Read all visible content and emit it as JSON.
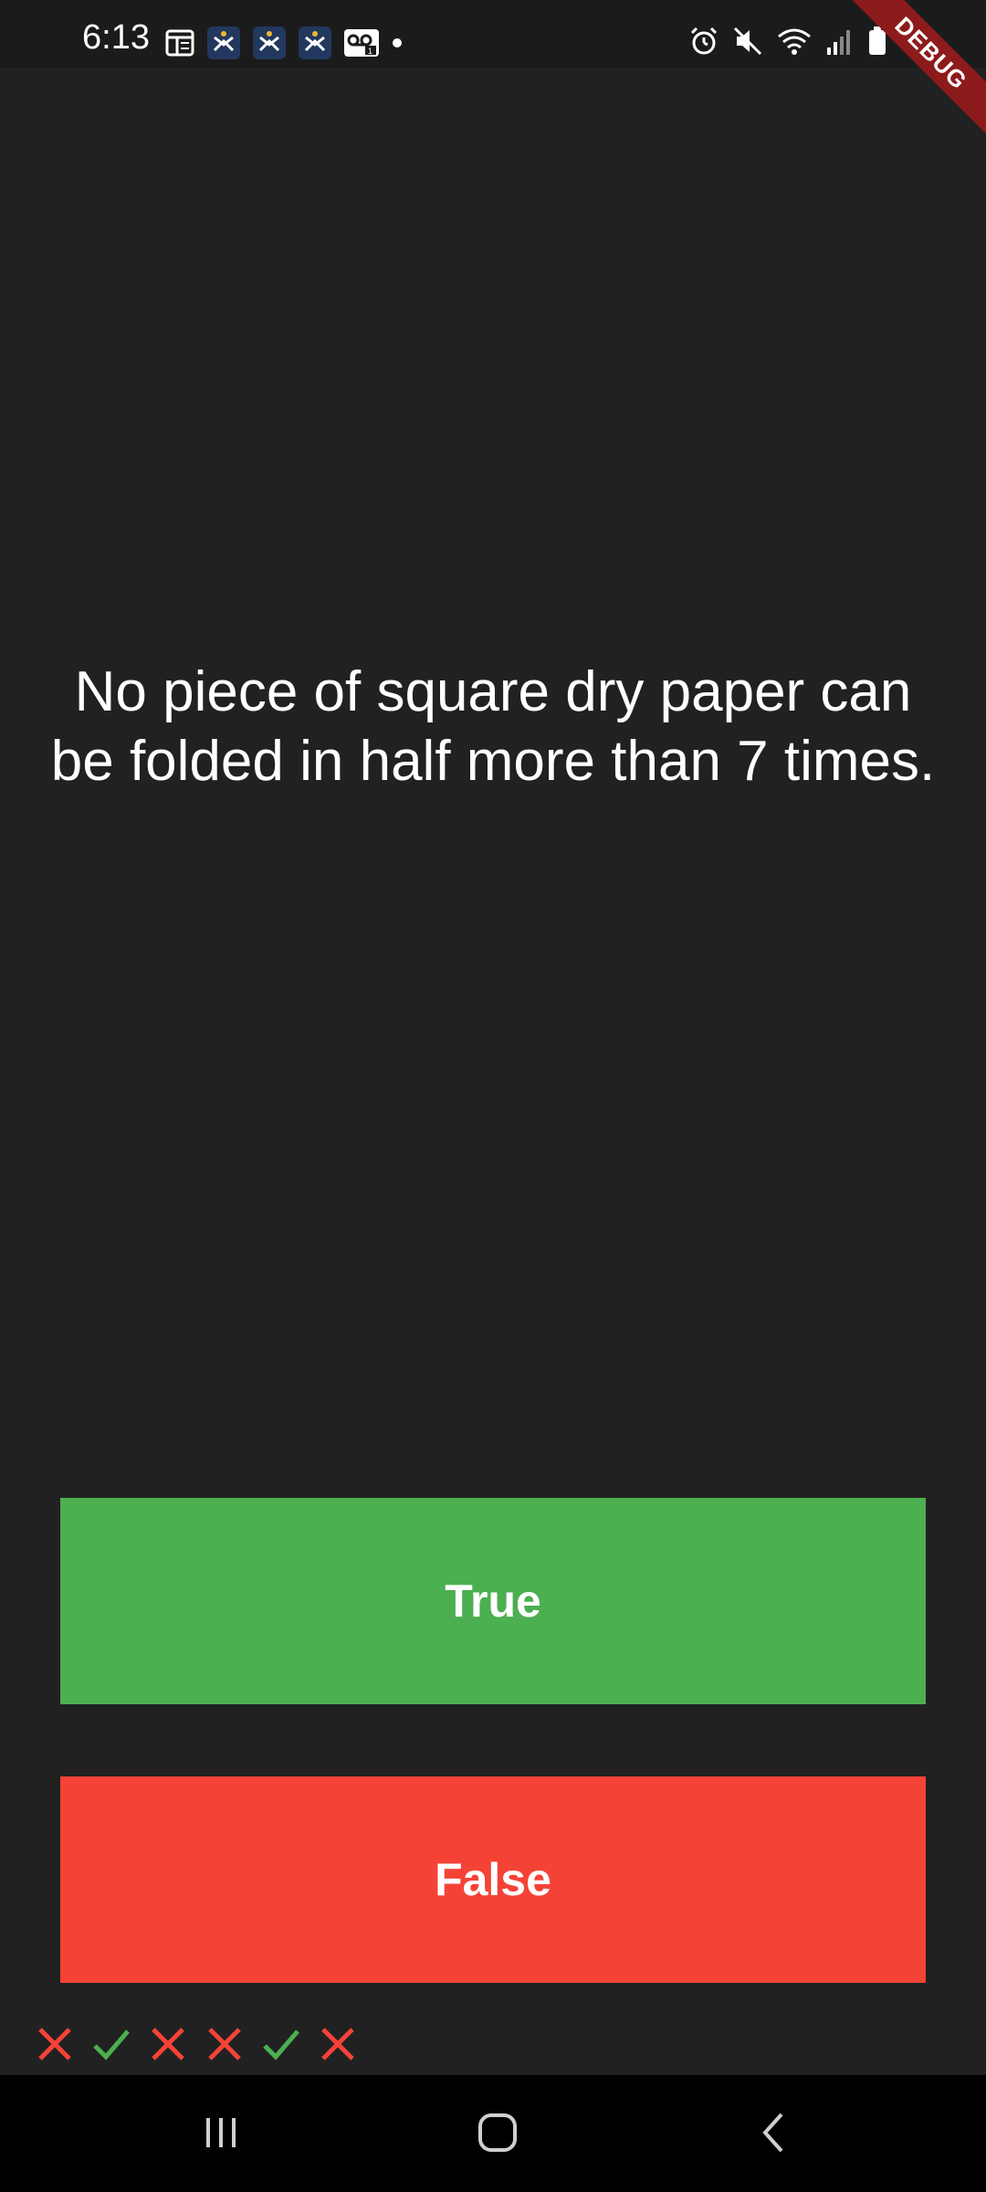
{
  "status_bar": {
    "time": "6:13",
    "left_icons": [
      "news-icon",
      "app-icon",
      "app-icon",
      "app-icon",
      "voicemail-icon",
      "dot-icon"
    ],
    "right_icons": [
      "alarm-icon",
      "mute-icon",
      "wifi-icon",
      "signal-icon",
      "battery-icon"
    ]
  },
  "debug_banner": {
    "label": "DEBUG"
  },
  "quiz": {
    "question": "No piece of square dry paper can be folded in half more than 7 times.",
    "true_label": "True",
    "false_label": "False"
  },
  "score_keeper": [
    "wrong",
    "correct",
    "wrong",
    "wrong",
    "correct",
    "wrong"
  ],
  "colors": {
    "background": "#212121",
    "true_button": "#4caf50",
    "false_button": "#f44336",
    "check_mark": "#4caf50",
    "cross_mark": "#f44336",
    "debug_banner": "#8e1b1b"
  },
  "nav_bar": {
    "buttons": [
      "recents-icon",
      "home-icon",
      "back-icon"
    ]
  }
}
